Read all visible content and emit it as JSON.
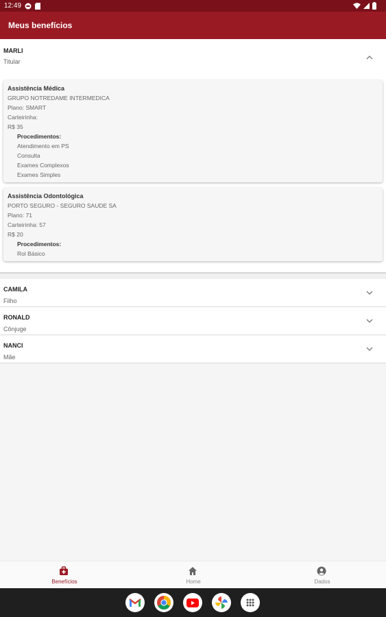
{
  "status_bar": {
    "time": "12:49"
  },
  "app_bar": {
    "title": "Meus benefícios"
  },
  "members": [
    {
      "name": "MARLI",
      "role": "Titular",
      "expanded": true,
      "benefits": [
        {
          "title": "Assistência Médica",
          "provider": "GRUPO NOTREDAME INTERMEDICA",
          "plan": "Plano: SMART",
          "card": "Carteirinha:",
          "price": "R$ 35",
          "procedures_label": "Procedimentos:",
          "procedures": [
            "Atendimento em PS",
            "Consulta",
            "Exames Complexos",
            "Exames Simples"
          ]
        },
        {
          "title": "Assistência Odontológica",
          "provider": "PORTO SEGURO - SEGURO SAUDE SA",
          "plan": "Plano: 71",
          "card": "Carteirinha: 57",
          "price": "R$ 20",
          "procedures_label": "Procedimentos:",
          "procedures": [
            "Rol Básico"
          ]
        }
      ]
    },
    {
      "name": "CAMILA",
      "role": "Filho",
      "expanded": false
    },
    {
      "name": "RONALD",
      "role": "Cônjuge",
      "expanded": false
    },
    {
      "name": "NANCI",
      "role": "Mãe",
      "expanded": false
    }
  ],
  "bottom_nav": [
    {
      "label": "Benefícios",
      "icon": "medical-bag-icon",
      "active": true
    },
    {
      "label": "Home",
      "icon": "home-icon",
      "active": false
    },
    {
      "label": "Dados",
      "icon": "account-circle-icon",
      "active": false
    }
  ],
  "dock": [
    "gmail-icon",
    "chrome-icon",
    "youtube-icon",
    "photos-icon",
    "app-drawer-icon"
  ],
  "colors": {
    "primary": "#9a1a24",
    "status_bar": "#7a111a"
  }
}
